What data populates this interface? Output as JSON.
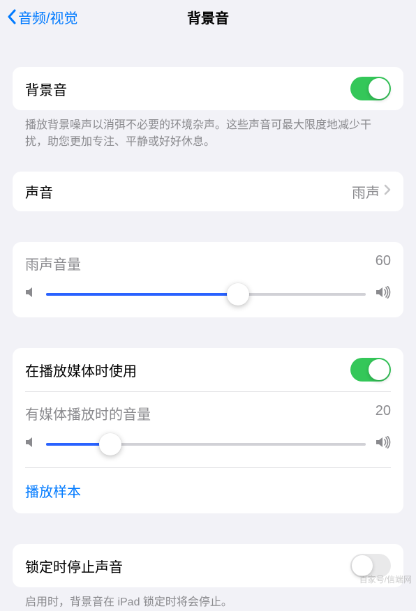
{
  "header": {
    "back_label": "音频/视觉",
    "title": "背景音"
  },
  "main_toggle": {
    "label": "背景音",
    "on": true,
    "description": "播放背景噪声以消弭不必要的环境杂声。这些声音可最大限度地减少干扰，助您更加专注、平静或好好休息。"
  },
  "sound_row": {
    "label": "声音",
    "value": "雨声"
  },
  "volume": {
    "label": "雨声音量",
    "value": "60",
    "percent": 60
  },
  "media": {
    "toggle_label": "在播放媒体时使用",
    "toggle_on": true,
    "volume_label": "有媒体播放时的音量",
    "volume_value": "20",
    "volume_percent": 20,
    "sample_label": "播放样本"
  },
  "lock": {
    "label": "锁定时停止声音",
    "on": false,
    "description": "启用时，背景音在 iPad 锁定时将会停止。"
  },
  "watermark": "百家号/信端网"
}
